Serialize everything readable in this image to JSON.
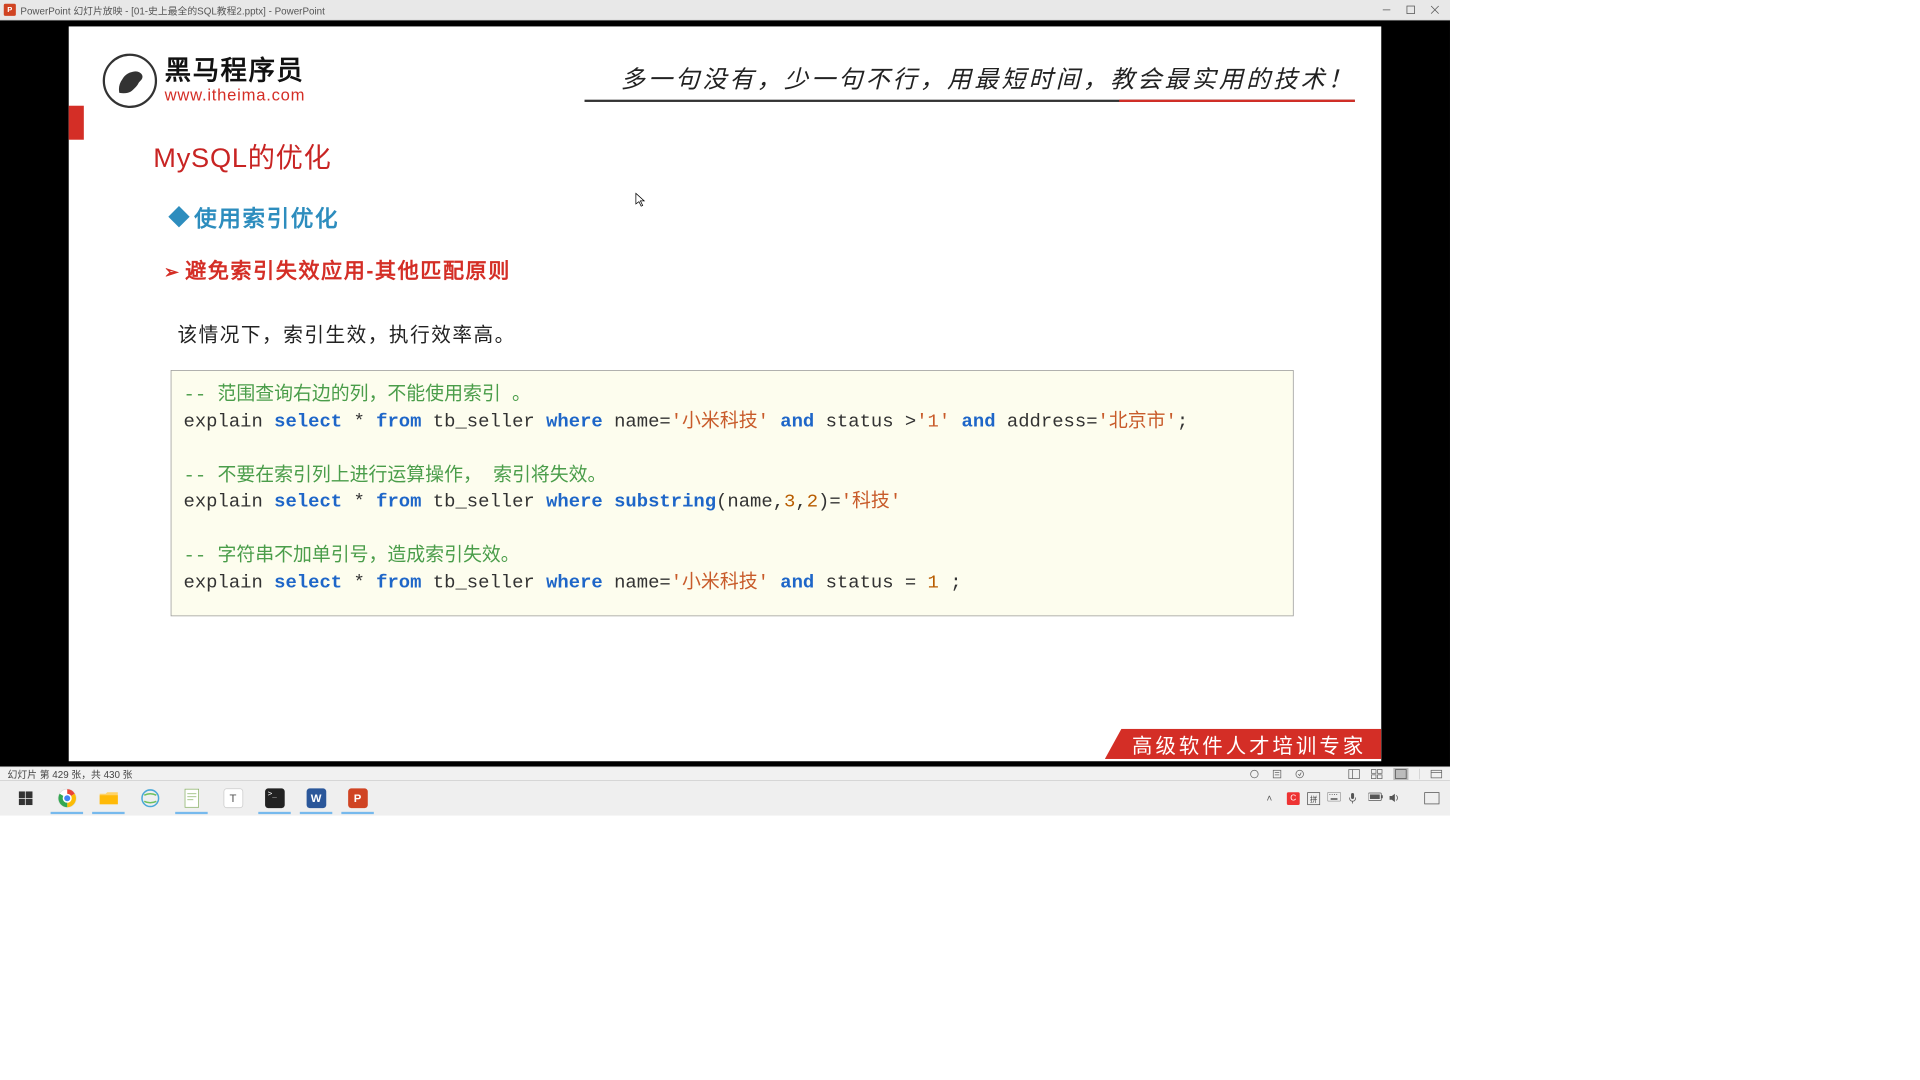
{
  "window": {
    "title": "PowerPoint 幻灯片放映 - [01-史上最全的SQL教程2.pptx] - PowerPoint"
  },
  "slide": {
    "logo_cn": "黑马程序员",
    "logo_en": "www.itheima.com",
    "slogan": "多一句没有，少一句不行，用最短时间，教会最实用的技术！",
    "title": "MySQL的优化",
    "subtitle1": "使用索引优化",
    "subtitle2": "避免索引失效应用-其他匹配原则",
    "paragraph": "该情况下，索引生效，执行效率高。",
    "footer": "高级软件人才培训专家",
    "code": {
      "l1_comment": "-- 范围查询右边的列，不能使用索引 。",
      "l2_a": "explain ",
      "l2_select": "select",
      "l2_b": " * ",
      "l2_from": "from",
      "l2_c": " tb_seller ",
      "l2_where": "where",
      "l2_d": " name=",
      "l2_s1": "'小米科技'",
      "l2_e": " ",
      "l2_and1": "and",
      "l2_f": " status >",
      "l2_s2": "'1'",
      "l2_g": " ",
      "l2_and2": "and",
      "l2_h": " address=",
      "l2_s3": "'北京市'",
      "l2_i": ";",
      "l4_comment": "-- 不要在索引列上进行运算操作， 索引将失效。",
      "l5_a": "explain ",
      "l5_select": "select",
      "l5_b": " * ",
      "l5_from": "from",
      "l5_c": " tb_seller ",
      "l5_where": "where",
      "l5_d": " ",
      "l5_sub": "substring",
      "l5_e": "(name,",
      "l5_n1": "3",
      "l5_f": ",",
      "l5_n2": "2",
      "l5_g": ")=",
      "l5_s1": "'科技'",
      "l7_comment": "-- 字符串不加单引号，造成索引失效。",
      "l8_a": "explain ",
      "l8_select": "select",
      "l8_b": " * ",
      "l8_from": "from",
      "l8_c": " tb_seller ",
      "l8_where": "where",
      "l8_d": " name=",
      "l8_s1": "'小米科技'",
      "l8_e": " ",
      "l8_and1": "and",
      "l8_f": " status = ",
      "l8_n1": "1",
      "l8_g": " ;"
    }
  },
  "statusbar": {
    "left": "幻灯片 第 429 张，共 430 张"
  },
  "tray": {
    "time": "",
    "icons": [
      "up",
      "c-red",
      "pinyin",
      "keyboard",
      "mic",
      "battery",
      "volume"
    ]
  }
}
